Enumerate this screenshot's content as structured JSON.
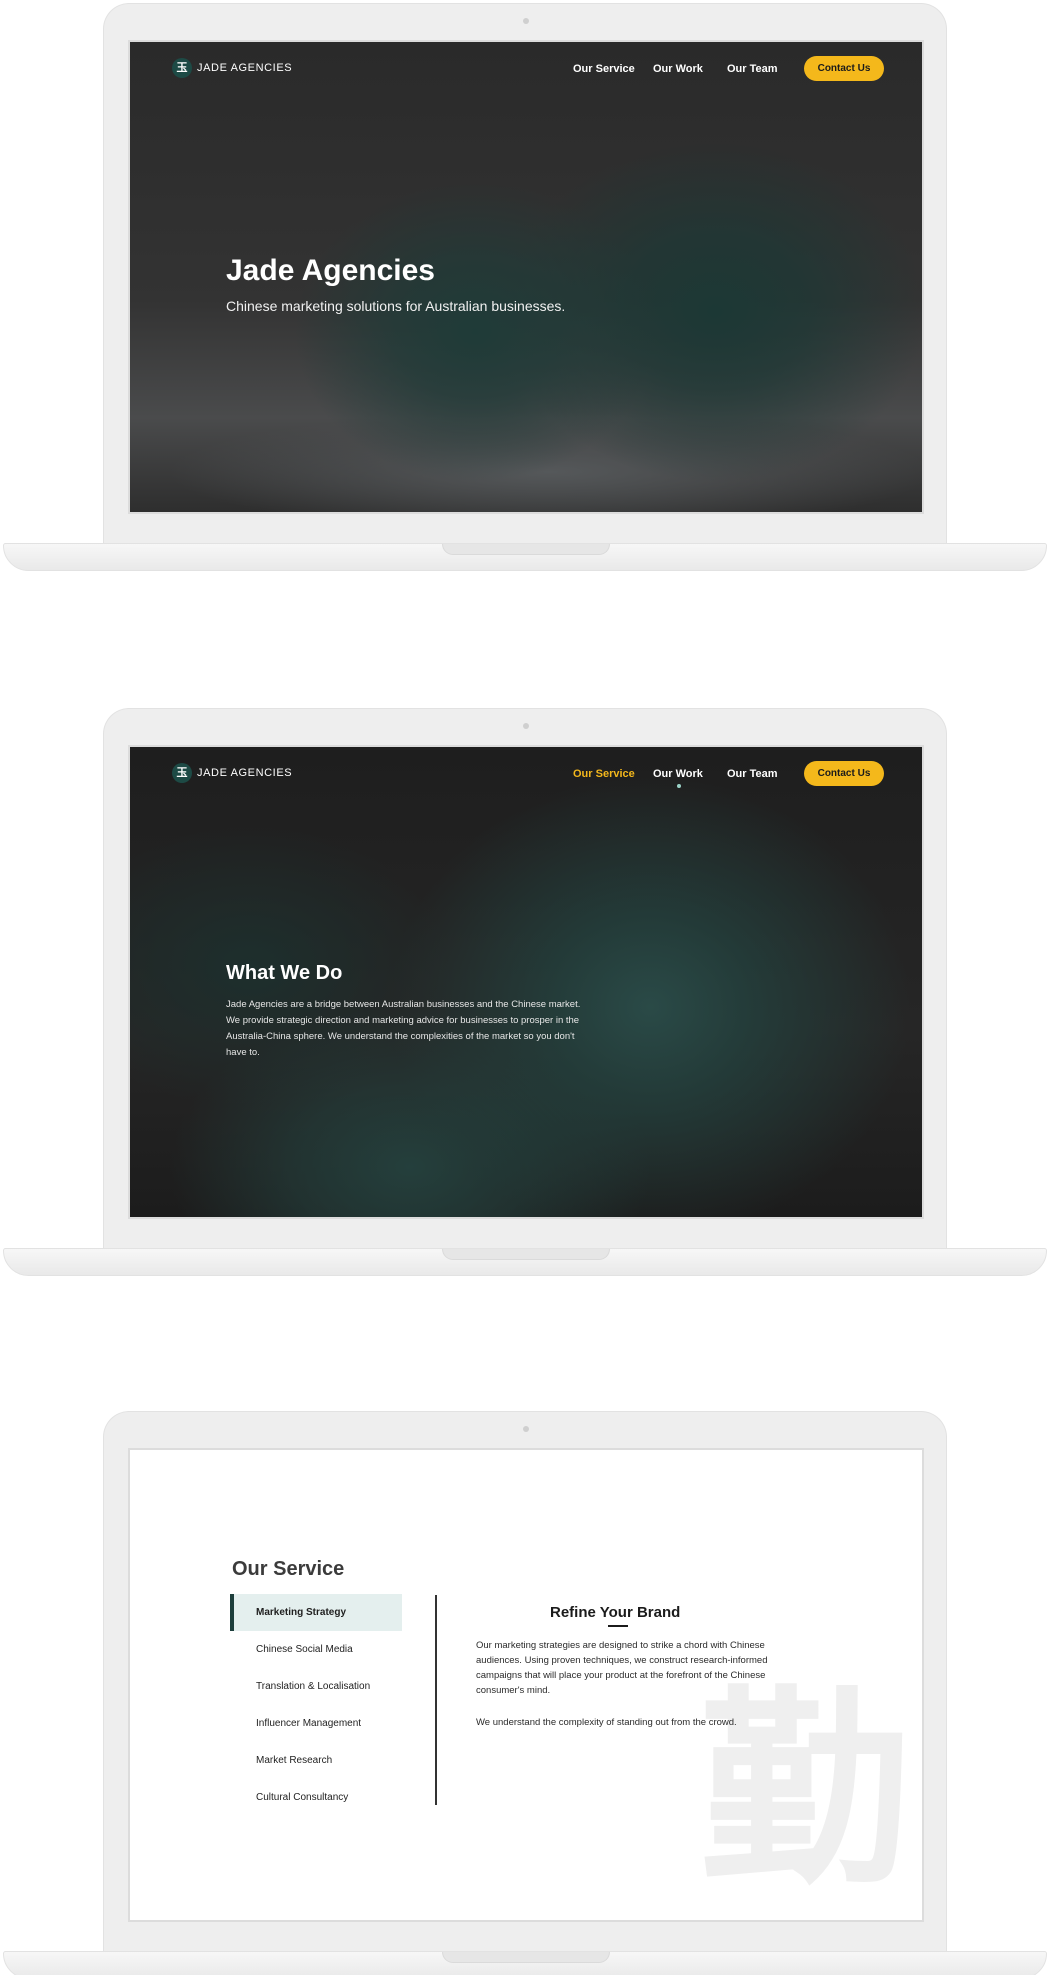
{
  "brand": {
    "name": "JADE AGENCIES",
    "logo_glyph": "玉",
    "accent_color": "#f4b81b",
    "brand_green": "#1d4a45"
  },
  "nav": {
    "items": [
      "Our Service",
      "Our Work",
      "Our Team"
    ],
    "contact_label": "Contact Us"
  },
  "hero": {
    "title": "Jade Agencies",
    "subtitle": "Chinese marketing solutions for Australian businesses."
  },
  "what_we_do": {
    "active_nav": "Our Service",
    "title": "What We Do",
    "body": "Jade Agencies are a bridge between Australian businesses and the Chinese market. We provide strategic direction and marketing advice for businesses to prosper in the Australia-China sphere. We understand the complexities of the market so you don't have to."
  },
  "service": {
    "title": "Our Service",
    "items": [
      "Marketing Strategy",
      "Chinese Social Media",
      "Translation & Localisation",
      "Influencer Management",
      "Market Research",
      "Cultural Consultancy"
    ],
    "active_item": "Marketing Strategy",
    "heading": "Refine Your Brand",
    "paragraph_1": "Our marketing strategies are designed to strike a chord with Chinese audiences. Using proven techniques, we construct research-informed campaigns that will place your product at the forefront of the Chinese consumer's mind.",
    "paragraph_2": "We understand the complexity of standing out from the crowd.",
    "watermark_glyph": "勤"
  }
}
